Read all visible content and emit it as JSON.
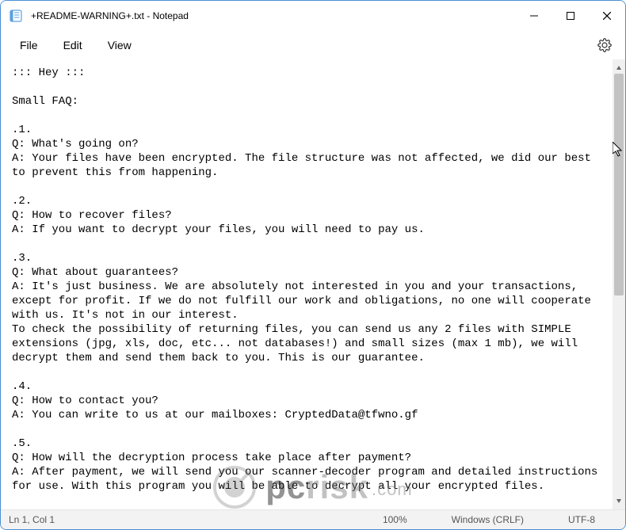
{
  "titlebar": {
    "title": "+README-WARNING+.txt - Notepad"
  },
  "menubar": {
    "file": "File",
    "edit": "Edit",
    "view": "View"
  },
  "document": {
    "text": "::: Hey :::\n\nSmall FAQ:\n\n.1.\nQ: What's going on?\nA: Your files have been encrypted. The file structure was not affected, we did our best to prevent this from happening.\n\n.2.\nQ: How to recover files?\nA: If you want to decrypt your files, you will need to pay us.\n\n.3.\nQ: What about guarantees?\nA: It's just business. We are absolutely not interested in you and your transactions, except for profit. If we do not fulfill our work and obligations, no one will cooperate with us. It's not in our interest.\nTo check the possibility of returning files, you can send us any 2 files with SIMPLE extensions (jpg, xls, doc, etc... not databases!) and small sizes (max 1 mb), we will decrypt them and send them back to you. This is our guarantee.\n\n.4.\nQ: How to contact you?\nA: You can write to us at our mailboxes: CryptedData@tfwno.gf\n\n.5.\nQ: How will the decryption process take place after payment?\nA: After payment, we will send you our scanner-decoder program and detailed instructions for use. With this program you will be able to decrypt all your encrypted files."
  },
  "statusbar": {
    "position": "Ln 1, Col 1",
    "zoom": "100%",
    "lineending": "Windows (CRLF)",
    "encoding": "UTF-8"
  },
  "watermark": {
    "brand_prefix": "pc",
    "brand_suffix": "risk",
    "tld": ".com"
  }
}
